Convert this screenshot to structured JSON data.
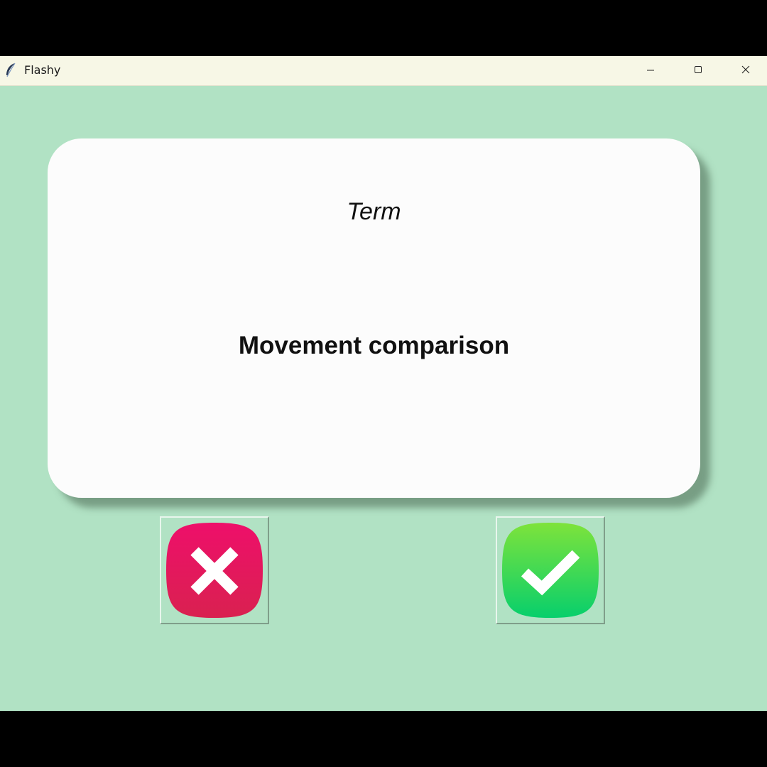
{
  "window": {
    "title": "Flashy",
    "app_icon": "feather-icon",
    "controls": {
      "minimize_icon": "minimize-icon",
      "maximize_icon": "maximize-icon",
      "close_icon": "close-icon"
    }
  },
  "card": {
    "title": "Term",
    "word": "Movement comparison"
  },
  "buttons": {
    "wrong_icon": "cross-icon",
    "right_icon": "checkmark-icon"
  },
  "colors": {
    "background": "#b1e2c4",
    "card": "#fcfcfc",
    "wrong": "#e41361",
    "right": "#18d45f"
  }
}
